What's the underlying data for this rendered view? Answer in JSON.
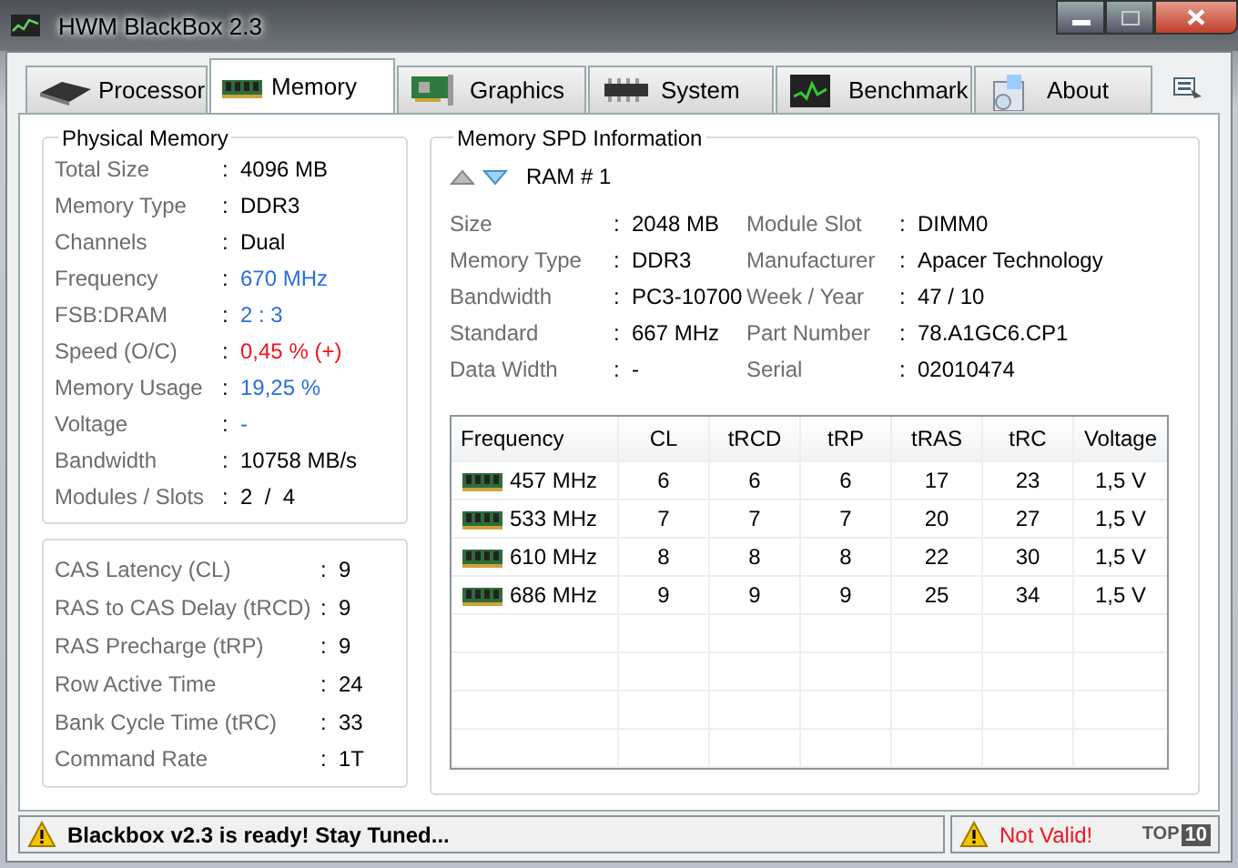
{
  "window": {
    "title": "HWM BlackBox 2.3"
  },
  "tabs": [
    {
      "label": "Processor",
      "selected": false
    },
    {
      "label": "Memory",
      "selected": true
    },
    {
      "label": "Graphics",
      "selected": false
    },
    {
      "label": "System",
      "selected": false
    },
    {
      "label": "Benchmark",
      "selected": false
    },
    {
      "label": "About",
      "selected": false
    }
  ],
  "physical_memory": {
    "title": "Physical Memory",
    "separator": ":",
    "rows": [
      {
        "label": "Total Size",
        "value": "4096 MB",
        "kind": "plain"
      },
      {
        "label": "Memory Type",
        "value": "DDR3",
        "kind": "plain"
      },
      {
        "label": "Channels",
        "value": "Dual",
        "kind": "plain"
      },
      {
        "label": "Frequency",
        "value": "670 MHz",
        "kind": "info"
      },
      {
        "label": "FSB:DRAM",
        "value": "2 : 3",
        "kind": "info"
      },
      {
        "label": "Speed (O/C)",
        "value": "0,45 % (+)",
        "kind": "alert"
      },
      {
        "label": "Memory Usage",
        "value": "19,25 %",
        "kind": "info"
      },
      {
        "label": "Voltage",
        "value": "-",
        "kind": "info"
      },
      {
        "label": "Bandwidth",
        "value": "10758 MB/s",
        "kind": "plain"
      },
      {
        "label": "Modules / Slots",
        "value": "2  /  4",
        "kind": "plain"
      }
    ]
  },
  "timings": {
    "separator": ":",
    "rows": [
      {
        "label": "CAS Latency (CL)",
        "value": "9"
      },
      {
        "label": "RAS to CAS Delay (tRCD)",
        "value": "9"
      },
      {
        "label": "RAS Precharge (tRP)",
        "value": "9"
      },
      {
        "label": "Row Active Time",
        "value": "24"
      },
      {
        "label": "Bank Cycle Time (tRC)",
        "value": "33"
      },
      {
        "label": "Command Rate",
        "value": "1T"
      }
    ]
  },
  "spd": {
    "title": "Memory SPD Information",
    "module": "RAM # 1",
    "separator": ":",
    "left": [
      {
        "label": "Size",
        "value": "2048 MB"
      },
      {
        "label": "Memory Type",
        "value": "DDR3"
      },
      {
        "label": "Bandwidth",
        "value": "PC3-10700"
      },
      {
        "label": "Standard",
        "value": "667 MHz"
      },
      {
        "label": "Data Width",
        "value": "-"
      }
    ],
    "right": [
      {
        "label": "Module Slot",
        "value": "DIMM0"
      },
      {
        "label": "Manufacturer",
        "value": "Apacer Technology"
      },
      {
        "label": "Week / Year",
        "value": "47 / 10"
      },
      {
        "label": "Part Number",
        "value": "78.A1GC6.CP1"
      },
      {
        "label": "Serial",
        "value": "02010474"
      }
    ],
    "table": {
      "columns": [
        "Frequency",
        "CL",
        "tRCD",
        "tRP",
        "tRAS",
        "tRC",
        "Voltage"
      ],
      "rows": [
        [
          "457 MHz",
          "6",
          "6",
          "6",
          "17",
          "23",
          "1,5 V"
        ],
        [
          "533 MHz",
          "7",
          "7",
          "7",
          "20",
          "27",
          "1,5 V"
        ],
        [
          "610 MHz",
          "8",
          "8",
          "8",
          "22",
          "30",
          "1,5 V"
        ],
        [
          "686 MHz",
          "9",
          "9",
          "9",
          "25",
          "34",
          "1,5 V"
        ]
      ]
    }
  },
  "status_bar": {
    "message": "Blackbox v2.3 is ready! Stay Tuned...",
    "validity": "Not Valid!",
    "badge_text": "TOP",
    "badge_number": "10"
  }
}
